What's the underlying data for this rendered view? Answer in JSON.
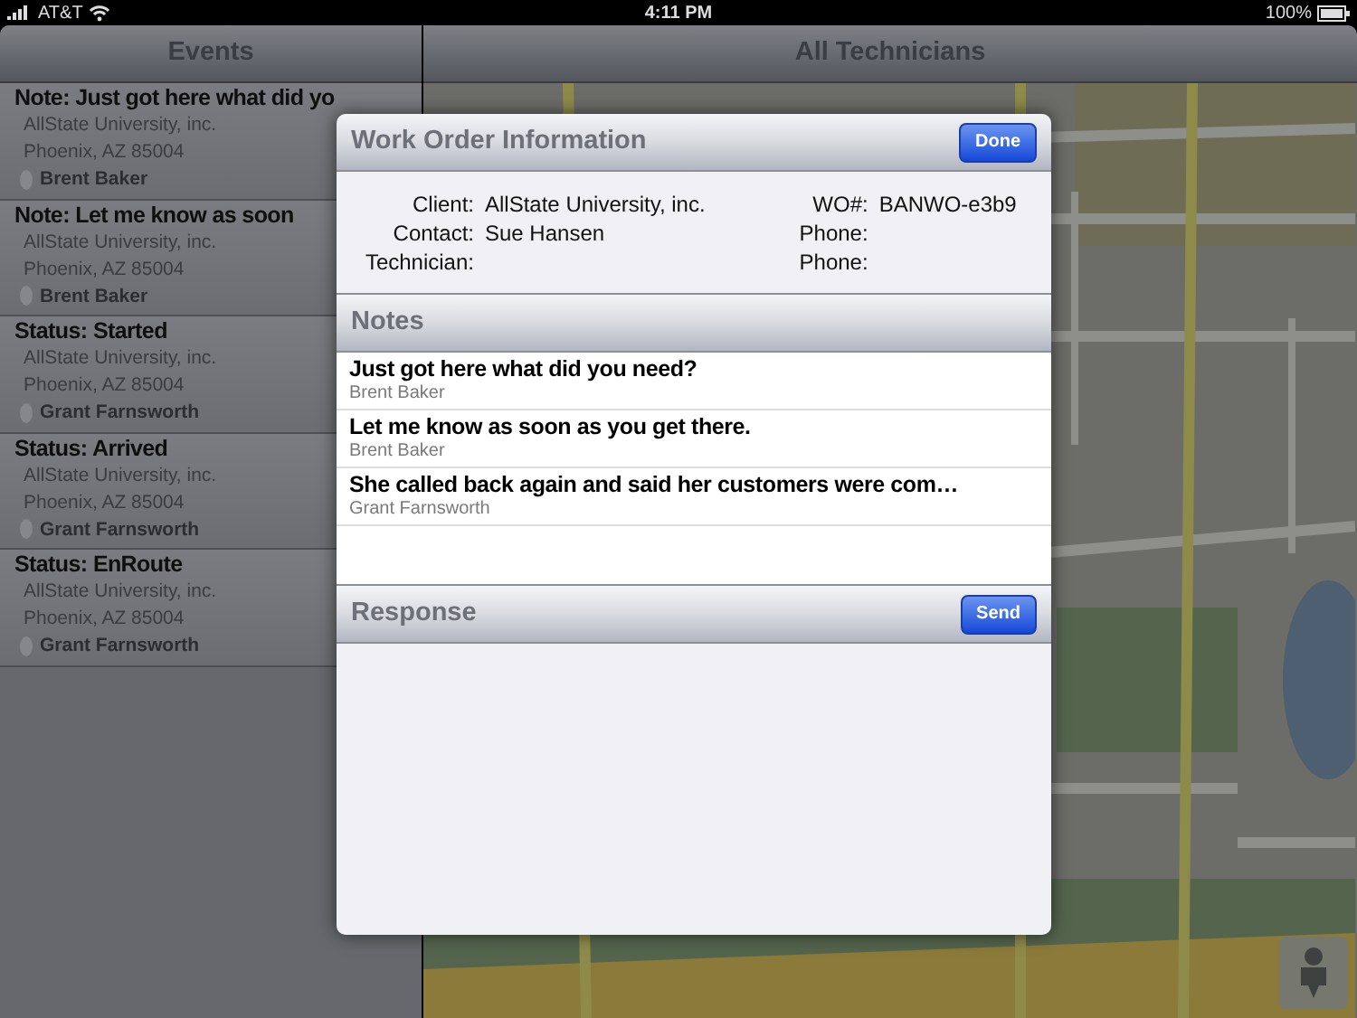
{
  "status_bar": {
    "carrier": "AT&T",
    "time": "4:11 PM",
    "battery": "100%"
  },
  "sidebar": {
    "title": "Events",
    "items": [
      {
        "title": "Note: Just got here what did yo",
        "client": "AllState University, inc.",
        "address": "Phoenix, AZ 85004",
        "technician": "Brent Baker"
      },
      {
        "title": "Note: Let me know as soon",
        "client": "AllState University, inc.",
        "address": "Phoenix, AZ 85004",
        "technician": "Brent Baker"
      },
      {
        "title": "Status: Started",
        "client": "AllState University, inc.",
        "address": "Phoenix, AZ 85004",
        "technician": "Grant Farnsworth"
      },
      {
        "title": "Status: Arrived",
        "client": "AllState University, inc.",
        "address": "Phoenix, AZ 85004",
        "technician": "Grant Farnsworth"
      },
      {
        "title": "Status: EnRoute",
        "client": "AllState University, inc.",
        "address": "Phoenix, AZ 85004",
        "technician": "Grant Farnsworth"
      }
    ]
  },
  "map_panel": {
    "title": "All Technicians"
  },
  "modal": {
    "title": "Work Order Information",
    "done_button": "Done",
    "info_left": [
      {
        "label": "Client:",
        "value": "AllState University, inc."
      },
      {
        "label": "Contact:",
        "value": "Sue Hansen"
      },
      {
        "label": "Technician:"
      }
    ],
    "info_right": [
      {
        "label": "WO#:",
        "value": "BANWO-e3b9"
      },
      {
        "label": "Phone:"
      },
      {
        "label": "Phone:"
      }
    ],
    "notes_title": "Notes",
    "notes": [
      {
        "text": "Just got here what did you need?",
        "author": "Brent Baker"
      },
      {
        "text": "Let me know as soon as you get there.",
        "author": "Brent Baker"
      },
      {
        "text": "She called back again and said her customers were com…",
        "author": "Grant Farnsworth"
      }
    ],
    "response_title": "Response",
    "send_button": "Send"
  }
}
